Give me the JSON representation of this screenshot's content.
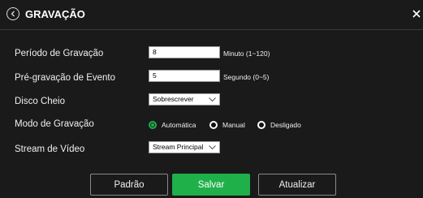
{
  "dialog": {
    "title": "GRAVAÇÃO",
    "back_icon": "back-circle-icon",
    "close_icon": "close-icon"
  },
  "form": {
    "period_label": "Período de Gravação",
    "period_value": "8",
    "period_hint": "Minuto (1~120)",
    "prerecord_label": "Pré-gravação de Evento",
    "prerecord_value": "5",
    "prerecord_hint": "Segundo (0~5)",
    "disk_label": "Disco Cheio",
    "disk_value": "Sobrescrever",
    "mode_label": "Modo de Gravação",
    "mode_options": [
      "Automática",
      "Manual",
      "Desligado"
    ],
    "mode_selected": "Automática",
    "stream_label": "Stream de Vídeo",
    "stream_value": "Stream Principal"
  },
  "buttons": {
    "default_label": "Padrão",
    "save_label": "Salvar",
    "refresh_label": "Atualizar"
  },
  "colors": {
    "accent": "#1fb04a",
    "background": "#1a1a1a"
  }
}
